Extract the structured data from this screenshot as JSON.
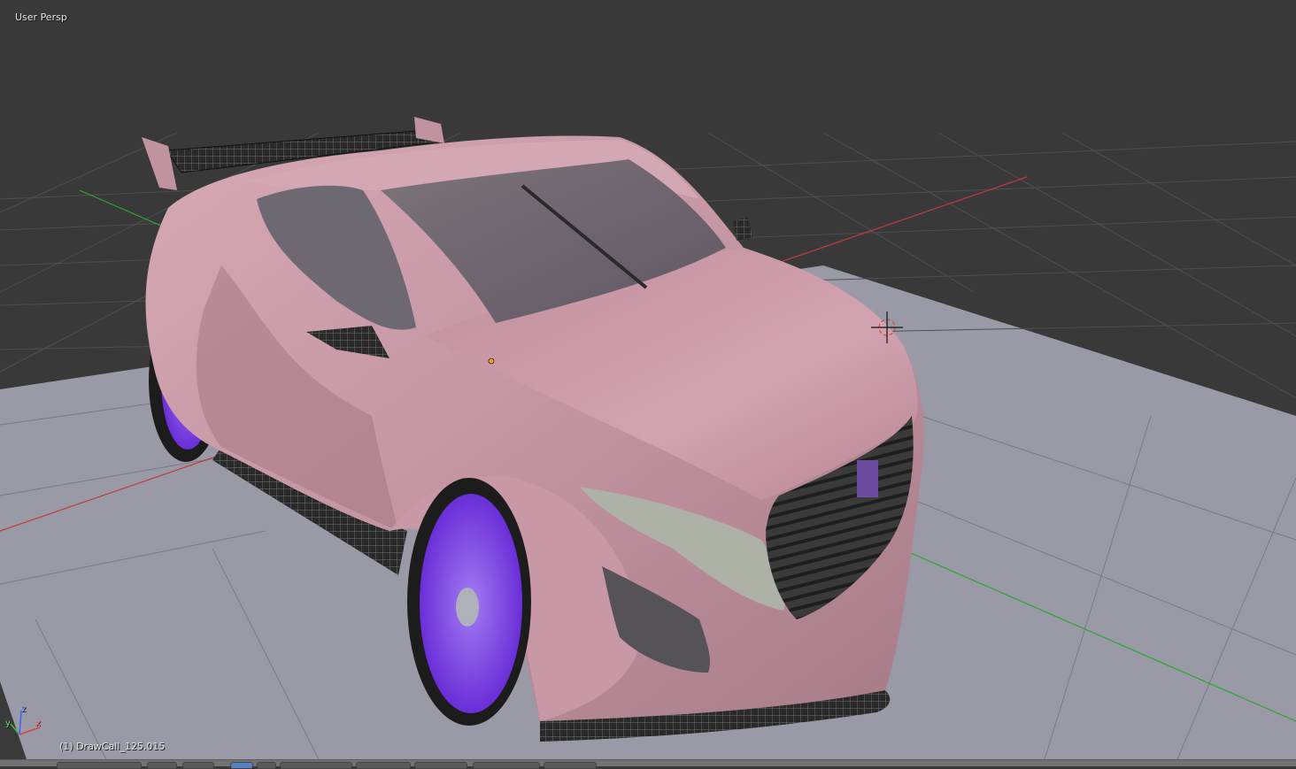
{
  "viewport": {
    "view_label": "User Persp",
    "object_label": "(1) DrawCall_125.015",
    "colors": {
      "background": "#393939",
      "grid_line": "#4f4f4f",
      "ground_plane": "#9a9aa6",
      "x_axis": "#c03c3c",
      "y_axis": "#2ea42e",
      "car_body": "#c99aa6",
      "car_body_shade": "#a17783",
      "glass": "#6f6770",
      "rim": "#7b3ff0",
      "tire": "#1c1c1c",
      "headlight": "#aeb2a6"
    },
    "gizmo": {
      "x_label": "x",
      "y_label": "y",
      "z_label": "z"
    }
  },
  "header": {
    "buttons": [
      "view-menu",
      "select-menu",
      "add-menu",
      "object-menu",
      "mode-selector",
      "shading-selector",
      "pivot-selector",
      "manipulator-toggle",
      "layer-buttons",
      "snap-toggle",
      "render-button"
    ]
  }
}
